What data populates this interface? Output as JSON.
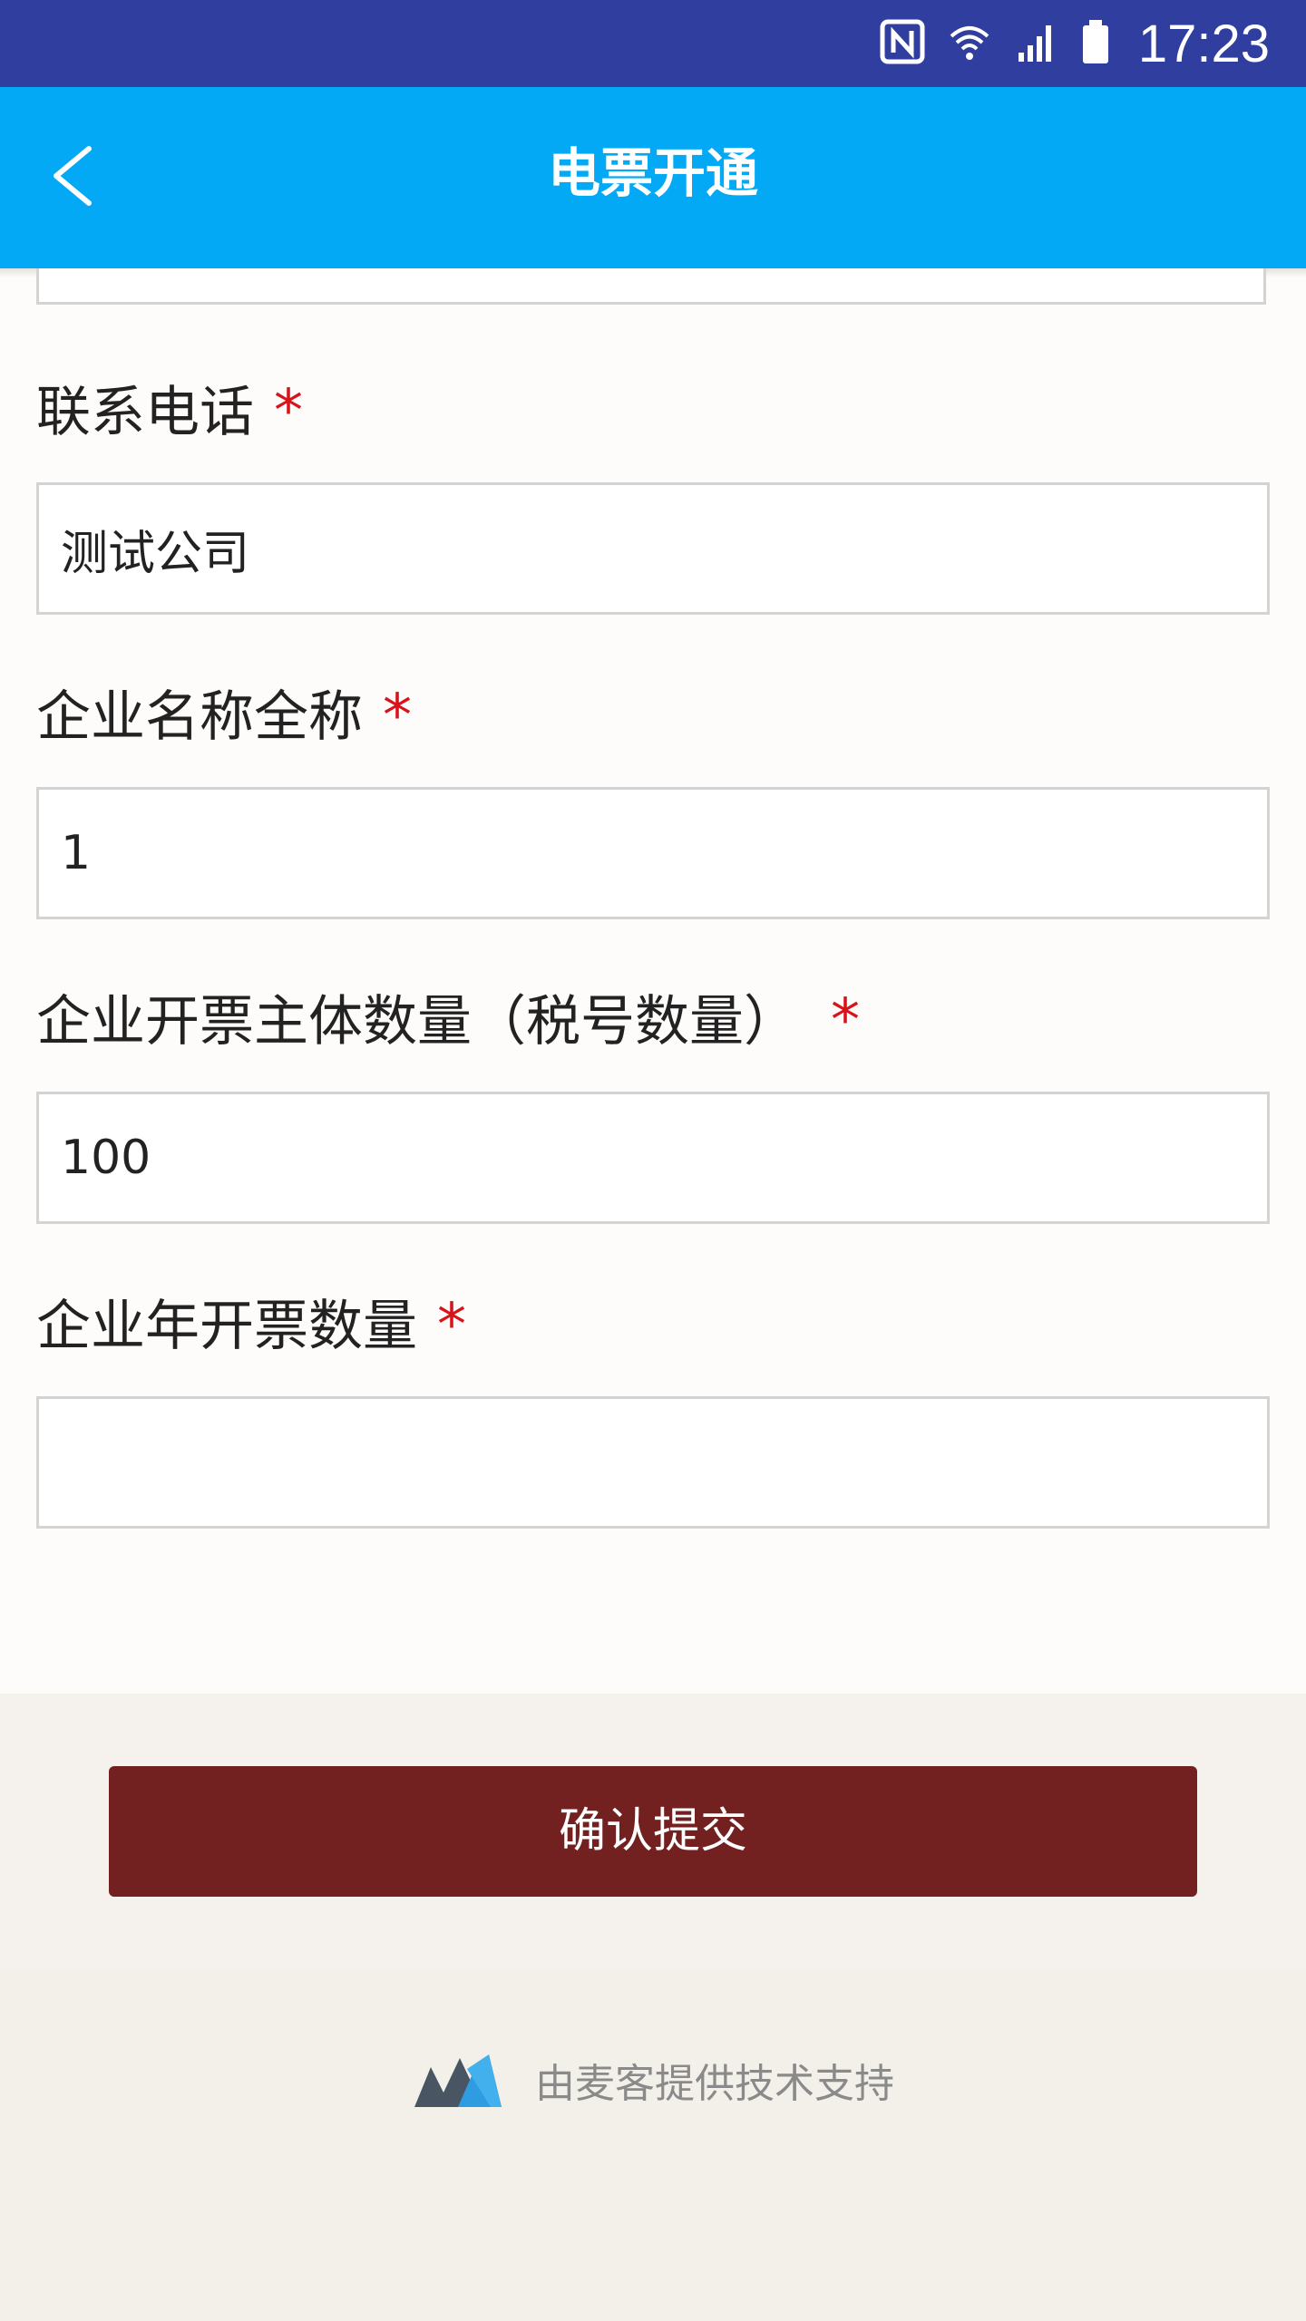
{
  "status_bar": {
    "time": "17:23",
    "icons": [
      "nfc-icon",
      "wifi-icon",
      "signal-icon",
      "battery-icon"
    ]
  },
  "app_bar": {
    "title": "电票开通",
    "back_icon": "chevron-left-icon"
  },
  "form": {
    "fields": [
      {
        "label": "联系电话",
        "required_mark": "*",
        "value": "测试公司",
        "placeholder": ""
      },
      {
        "label": "企业名称全称",
        "required_mark": "*",
        "value": "1",
        "placeholder": ""
      },
      {
        "label": "企业开票主体数量（税号数量）",
        "required_mark": "*",
        "value": "100",
        "placeholder": ""
      },
      {
        "label": "企业年开票数量",
        "required_mark": "*",
        "value": "",
        "placeholder": ""
      }
    ]
  },
  "submit": {
    "label": "确认提交"
  },
  "footer": {
    "logo_icon": "maike-logo-icon",
    "text": "由麦客提供技术支持"
  },
  "colors": {
    "status_bar": "#303f9f",
    "app_bar": "#03a9f4",
    "submit_button": "#732021",
    "required_mark": "#d8141b"
  }
}
